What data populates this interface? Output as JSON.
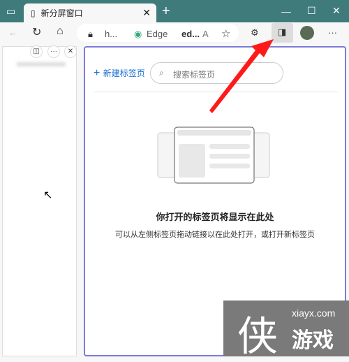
{
  "tab": {
    "title": "新分屏窗口",
    "close": "✕",
    "new": "+"
  },
  "window": {
    "minimize": "—",
    "maximize": "☐",
    "close": "✕"
  },
  "toolbar": {
    "back": "←",
    "reload": "↻",
    "home": "⌂",
    "url_short": "h...",
    "site_label": "Edge",
    "page_short": "ed...",
    "read_aloud": "A",
    "favorite": "☆",
    "extensions": "⚙",
    "more": "···"
  },
  "left_pane": {
    "split_btn": "◫",
    "more_btn": "···",
    "close_btn": "✕"
  },
  "right_pane": {
    "new_tab": "新建标签页",
    "search_placeholder": "搜索标签页",
    "heading": "你打开的标签页将显示在此处",
    "description": "可以从左侧标签页拖动链接以在此处打开，或打开新标签页"
  },
  "watermark": {
    "logo": "侠",
    "domain": "xiayx.com",
    "name": "游戏"
  },
  "colors": {
    "titlebar": "#3f7b7b",
    "accent": "#7b7bd6",
    "arrow": "#ff1a1a"
  }
}
